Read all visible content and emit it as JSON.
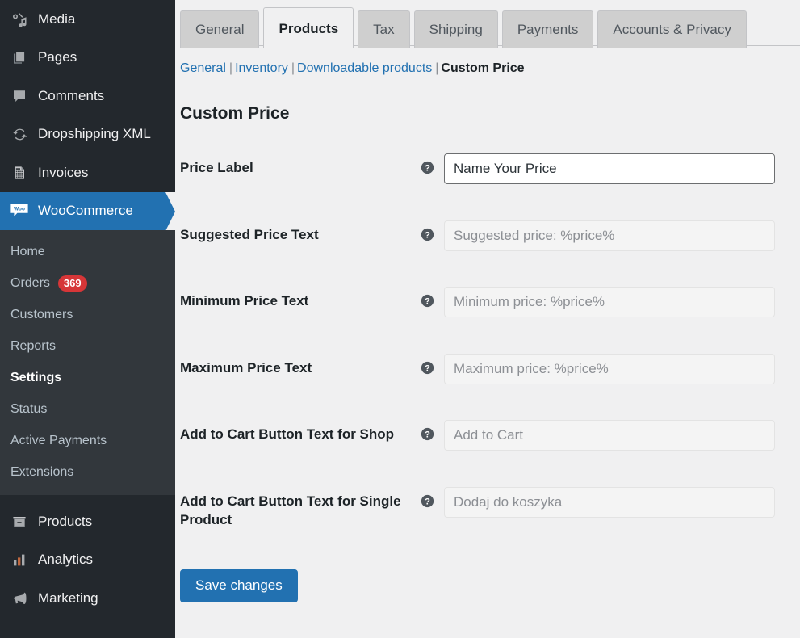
{
  "sidebar": {
    "top_items": [
      {
        "label": "Media",
        "icon": "media-icon",
        "current": false
      },
      {
        "label": "Pages",
        "icon": "pages-icon",
        "current": false
      },
      {
        "label": "Comments",
        "icon": "comments-icon",
        "current": false
      },
      {
        "label": "Dropshipping XML",
        "icon": "sync-icon",
        "current": false
      },
      {
        "label": "Invoices",
        "icon": "invoice-icon",
        "current": false
      },
      {
        "label": "WooCommerce",
        "icon": "woocommerce-icon",
        "current": true
      }
    ],
    "submenu": [
      {
        "label": "Home",
        "badge": "",
        "current": false
      },
      {
        "label": "Orders",
        "badge": "369",
        "current": false
      },
      {
        "label": "Customers",
        "badge": "",
        "current": false
      },
      {
        "label": "Reports",
        "badge": "",
        "current": false
      },
      {
        "label": "Settings",
        "badge": "",
        "current": true
      },
      {
        "label": "Status",
        "badge": "",
        "current": false
      },
      {
        "label": "Active Payments",
        "badge": "",
        "current": false
      },
      {
        "label": "Extensions",
        "badge": "",
        "current": false
      }
    ],
    "bottom_items": [
      {
        "label": "Products",
        "icon": "products-icon",
        "current": false
      },
      {
        "label": "Analytics",
        "icon": "analytics-icon",
        "current": false
      },
      {
        "label": "Marketing",
        "icon": "marketing-icon",
        "current": false
      }
    ]
  },
  "tabs": [
    {
      "label": "General",
      "active": false
    },
    {
      "label": "Products",
      "active": true
    },
    {
      "label": "Tax",
      "active": false
    },
    {
      "label": "Shipping",
      "active": false
    },
    {
      "label": "Payments",
      "active": false
    },
    {
      "label": "Accounts & Privacy",
      "active": false
    }
  ],
  "subnav": {
    "items": [
      {
        "label": "General",
        "current": false
      },
      {
        "label": "Inventory",
        "current": false
      },
      {
        "label": "Downloadable products",
        "current": false
      },
      {
        "label": "Custom Price",
        "current": true
      }
    ],
    "separator": "|"
  },
  "section": {
    "title": "Custom Price"
  },
  "fields": [
    {
      "label": "Price Label",
      "value": "Name Your Price",
      "placeholder": "",
      "state": "filled",
      "help": "help-icon"
    },
    {
      "label": "Suggested Price Text",
      "value": "",
      "placeholder": "Suggested price: %price%",
      "state": "empty",
      "help": "help-icon"
    },
    {
      "label": "Minimum Price Text",
      "value": "",
      "placeholder": "Minimum price: %price%",
      "state": "empty",
      "help": "help-icon"
    },
    {
      "label": "Maximum Price Text",
      "value": "",
      "placeholder": "Maximum price: %price%",
      "state": "empty",
      "help": "help-icon"
    },
    {
      "label": "Add to Cart Button Text for Shop",
      "value": "",
      "placeholder": "Add to Cart",
      "state": "empty",
      "help": "help-icon"
    },
    {
      "label": "Add to Cart Button Text for Single Product",
      "value": "",
      "placeholder": "Dodaj do koszyka",
      "state": "empty",
      "help": "help-icon"
    }
  ],
  "actions": {
    "save_label": "Save changes"
  },
  "colors": {
    "sidebar_bg": "#23282d",
    "submenu_bg": "#32373c",
    "accent_blue": "#2271b1",
    "badge_red": "#d63638",
    "content_bg": "#f0f0f1",
    "link_blue": "#2271b1"
  }
}
